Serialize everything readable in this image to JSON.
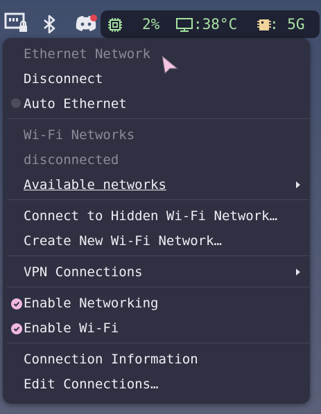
{
  "tray": {
    "icons": [
      "network-wired-locked-icon",
      "bluetooth-icon",
      "discord-icon"
    ],
    "cpu_value": "2%",
    "temp_value": ":38°C",
    "mem_value": ": 5G",
    "colors": {
      "bar_bg": "#1f2233",
      "stat_text": "#a6e3a1",
      "notification_dot": "#e64553"
    }
  },
  "menu": {
    "ethernet_header": "Ethernet Network",
    "disconnect": "Disconnect",
    "auto_ethernet": "Auto Ethernet",
    "wifi_header": "Wi-Fi Networks",
    "wifi_status": "disconnected",
    "available_networks": "Available networks",
    "connect_hidden": "Connect to Hidden Wi-Fi Network…",
    "create_new": "Create New Wi-Fi Network…",
    "vpn_connections": "VPN Connections",
    "enable_networking": "Enable Networking",
    "enable_wifi": "Enable Wi-Fi",
    "connection_info": "Connection Information",
    "edit_connections": "Edit Connections…",
    "colors": {
      "background": "#2f3041",
      "text": "#eef0f6",
      "disabled_text": "#8a8c99",
      "check_accent": "#f2b8de"
    }
  }
}
